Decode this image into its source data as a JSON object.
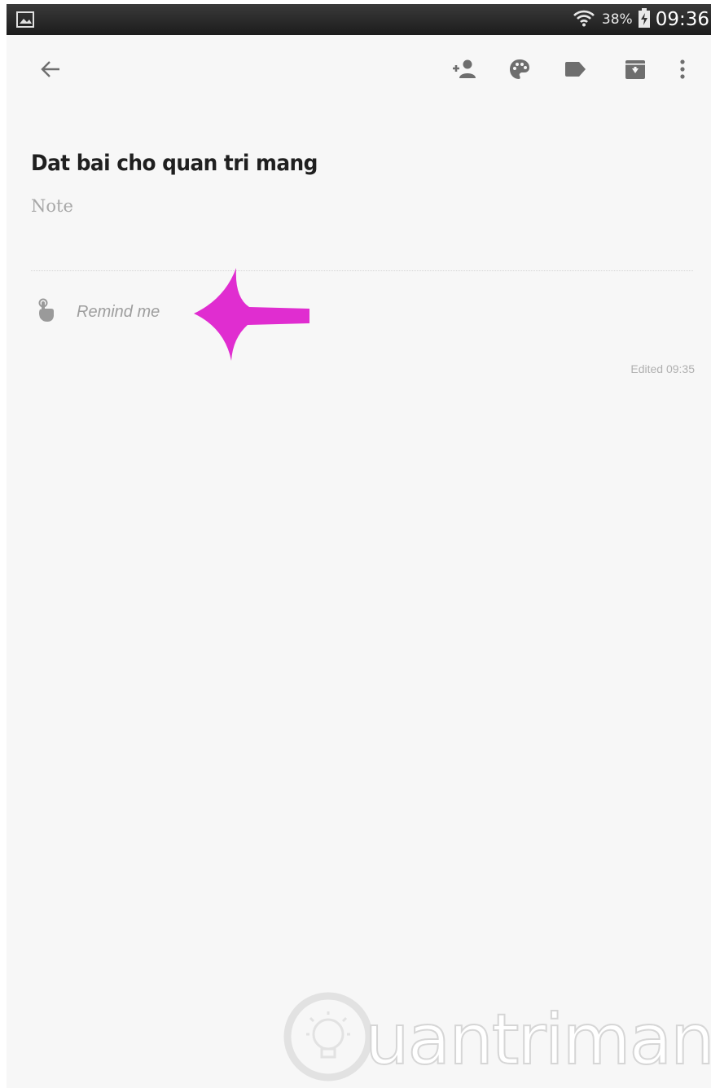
{
  "status_bar": {
    "battery_percent": "38%",
    "time": "09:36"
  },
  "toolbar": {
    "back": "arrow-left-icon",
    "collaborator": "person-add-icon",
    "color": "palette-icon",
    "label": "label-icon",
    "archive": "archive-icon",
    "more": "more-vert-icon"
  },
  "note": {
    "title": "Dat bai cho quan tri mang",
    "placeholder": "Note",
    "reminder_label": "Remind me",
    "edited": "Edited 09:35"
  },
  "annotation": {
    "arrow_color": "#e02dd0"
  },
  "watermark": {
    "text": "uantrimang"
  }
}
